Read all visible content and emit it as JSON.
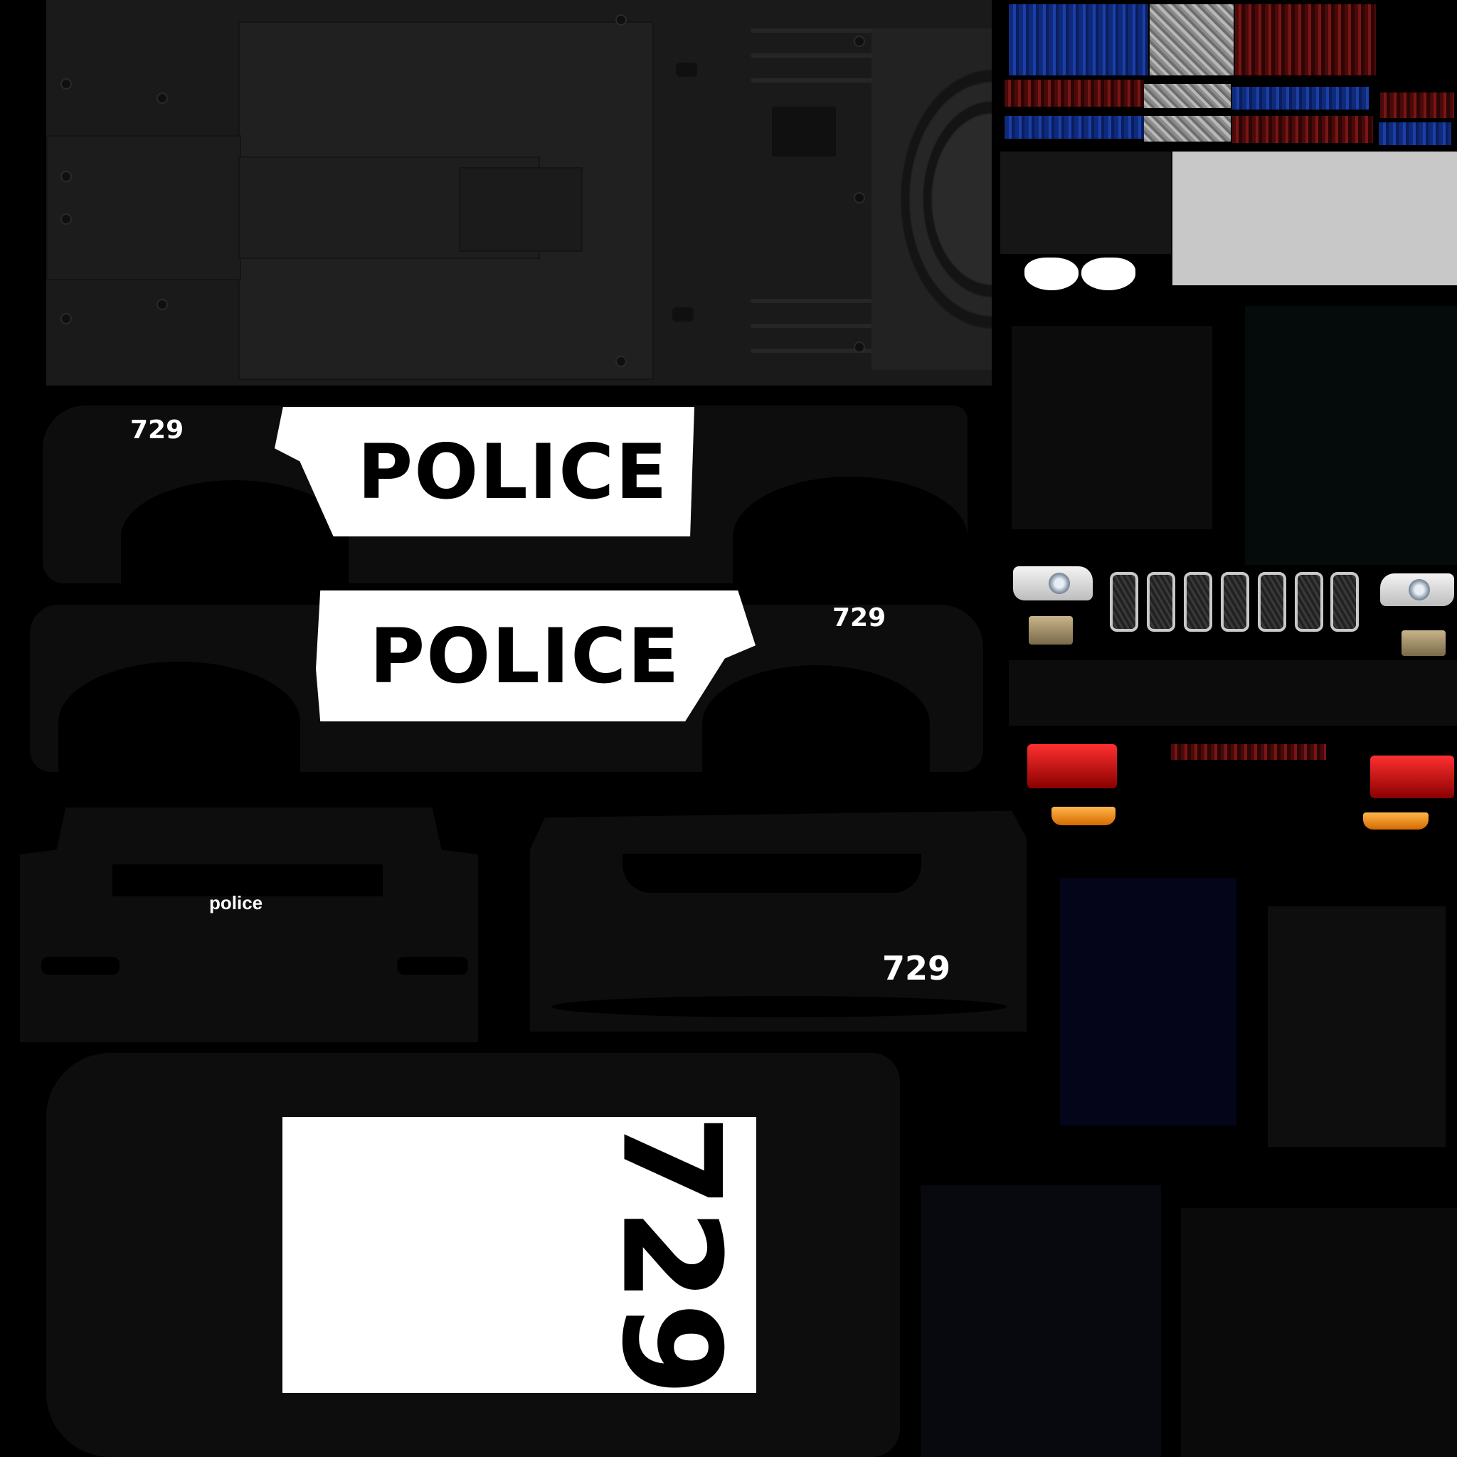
{
  "texture": {
    "side_left": {
      "unit_number": "729",
      "badge_text": "POLICE"
    },
    "side_right": {
      "unit_number": "729",
      "badge_text": "POLICE"
    },
    "front_label": "police",
    "rear_unit_number": "729",
    "roof_unit_number": "729"
  },
  "colors": {
    "background": "#000000",
    "body": "#0d0d0d",
    "undercarriage": "#1a1a1a",
    "badge": "#ffffff",
    "light_blue": "#1a3fa8",
    "light_red": "#7a1515",
    "panel_grey": "#c8c8c8",
    "panel_dark_blue": "#05051a"
  },
  "icons": [
    "headlight",
    "grille",
    "taillight",
    "turn-signal",
    "lightbar"
  ]
}
